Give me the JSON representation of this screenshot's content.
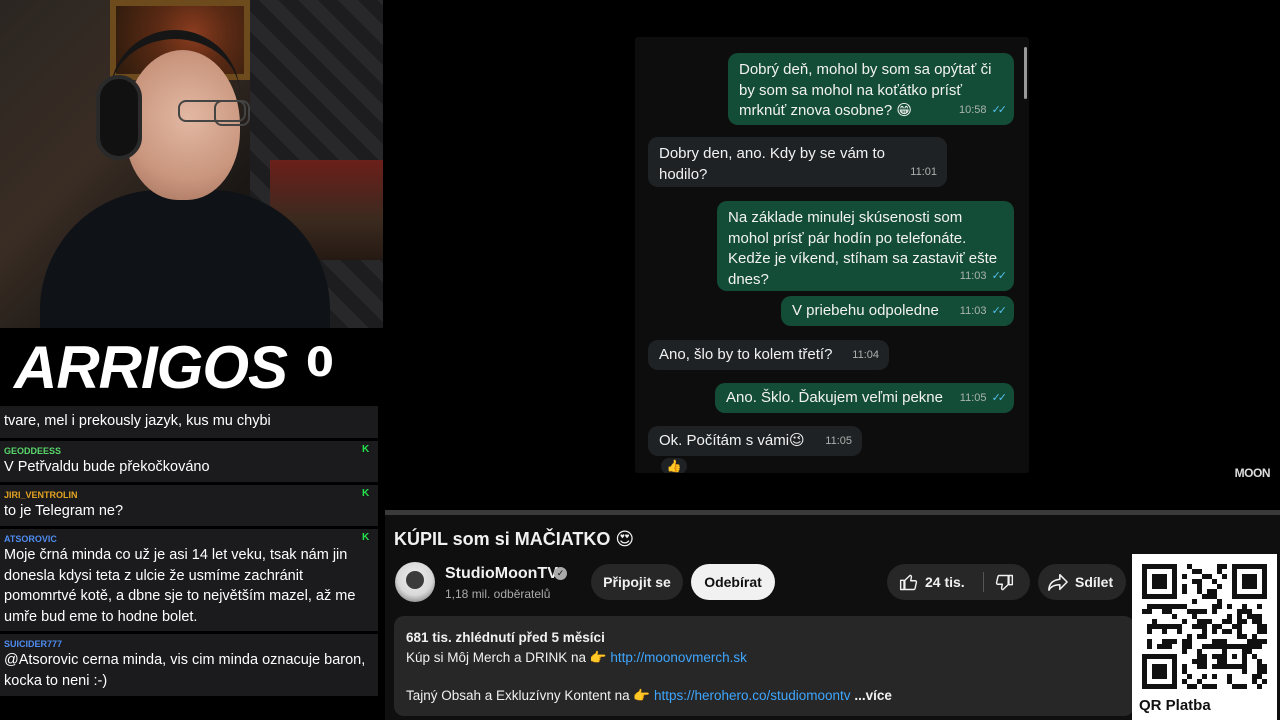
{
  "overlay": {
    "logo": "ARRIGOS",
    "score": "0"
  },
  "chat": [
    {
      "user": "",
      "user_color": "#ffffff",
      "text": "tvare, mel i prekously jazyk, kus mu chybi"
    },
    {
      "user": "GEODDEESS",
      "user_color": "#58d66b",
      "text": "V Petřvaldu bude překočkováno"
    },
    {
      "user": "JIRI_VENTROLIN",
      "user_color": "#e3a323",
      "text": "to je Telegram ne?"
    },
    {
      "user": "ATSOROVIC",
      "user_color": "#4f8cf0",
      "text": "Moje črná minda co už je asi 14 let veku, tsak nám jin donesla kdysi teta z ulcie že usmíme zachránit pomomrtvé kotě, a dbne sje to největším mazel, až me umře bud eme to hodne bolet."
    },
    {
      "user": "SUICIDER777",
      "user_color": "#4f8cf0",
      "text": "@Atsorovic cerna minda, vis cim minda oznacuje baron, kocka to neni :-)"
    }
  ],
  "chat_badge": "K",
  "messages": [
    {
      "dir": "out",
      "text": "Dobrý deň, mohol by som sa opýtať či by som sa mohol na koťátko prísť mrknúť znova osobne? 😁",
      "time": "10:58",
      "ticks": "✓✓"
    },
    {
      "dir": "in",
      "text": "Dobry den, ano. Kdy by se vám to hodilo?",
      "time": "11:01"
    },
    {
      "dir": "out",
      "text": "Na základe minulej skúsenosti som mohol prísť pár hodín po telefonáte. Kedže je víkend, stíham sa zastaviť ešte dnes?",
      "time": "11:03",
      "ticks": "✓✓"
    },
    {
      "dir": "out",
      "text": "V priebehu odpoledne",
      "time": "11:03",
      "ticks": "✓✓"
    },
    {
      "dir": "in",
      "text": "Ano, šlo by to kolem třetí?",
      "time": "11:04"
    },
    {
      "dir": "out",
      "text": "Ano. Šklo. Ďakujem veľmi pekne",
      "time": "11:05",
      "ticks": "✓✓"
    },
    {
      "dir": "in",
      "text": "Ok. Počítám s vámi😉",
      "time": "11:05"
    }
  ],
  "reaction": "👍",
  "watermark": "MOON",
  "video": {
    "title": "KÚPIL som si MAČIATKO 😍",
    "channel": "StudioMoonTV",
    "verified": "✓",
    "subscribers": "1,18 mil. odběratelů",
    "join_label": "Připojit se",
    "subscribe_label": "Odebírat",
    "likes": "24 tis.",
    "share_label": "Sdílet"
  },
  "description": {
    "meta": "681 tis. zhlédnutí  před 5 měsíci",
    "line1_prefix": "Kúp si Môj Merch a DRINK na 👉 ",
    "line1_link": "http://moonovmerch.sk",
    "line2_prefix": "Tajný Obsah a Exkluzívny Kontent na 👉 ",
    "line2_link": "https://herohero.co/studiomoontv",
    "more": " ...více"
  },
  "qr": {
    "label": "QR Platba"
  }
}
